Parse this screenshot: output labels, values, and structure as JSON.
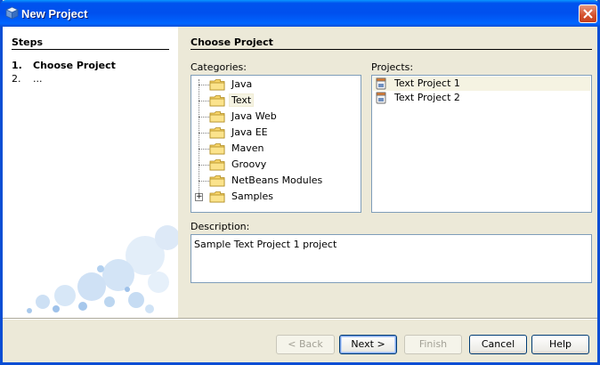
{
  "window": {
    "title": "New Project"
  },
  "steps": {
    "title": "Steps",
    "items": [
      {
        "num": "1.",
        "label": "Choose Project"
      },
      {
        "num": "2.",
        "label": "..."
      }
    ]
  },
  "main": {
    "title": "Choose Project",
    "categories_label": "Categories:",
    "projects_label": "Projects:",
    "description_label": "Description:",
    "categories": [
      {
        "label": "Java"
      },
      {
        "label": "Text"
      },
      {
        "label": "Java Web"
      },
      {
        "label": "Java EE"
      },
      {
        "label": "Maven"
      },
      {
        "label": "Groovy"
      },
      {
        "label": "NetBeans Modules"
      },
      {
        "label": "Samples"
      }
    ],
    "selected_category": "Text",
    "projects": [
      {
        "label": "Text Project 1"
      },
      {
        "label": "Text Project 2"
      }
    ],
    "selected_project": "Text Project 1",
    "description": "Sample Text Project 1 project"
  },
  "buttons": {
    "back": "< Back",
    "next": "Next >",
    "finish": "Finish",
    "cancel": "Cancel",
    "help": "Help"
  },
  "colors": {
    "titlebar": "#0053ee",
    "dialog_bg": "#ece9d8",
    "selection_bg": "#f5f3e2",
    "border": "#7f9db9"
  }
}
